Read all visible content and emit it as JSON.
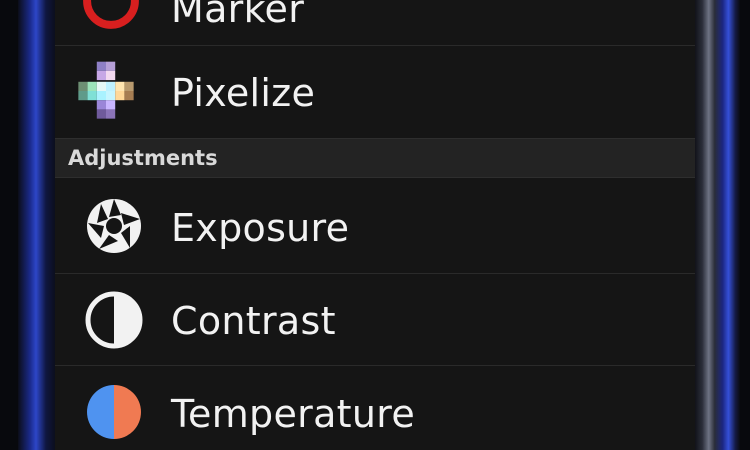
{
  "menu": {
    "items_top": [
      {
        "label": "Marker",
        "icon": "marker-ring-icon"
      },
      {
        "label": "Pixelize",
        "icon": "pixelize-icon"
      }
    ],
    "section": {
      "label": "Adjustments"
    },
    "items_adjust": [
      {
        "label": "Exposure",
        "icon": "aperture-icon"
      },
      {
        "label": "Contrast",
        "icon": "contrast-icon"
      },
      {
        "label": "Temperature",
        "icon": "temperature-icon"
      }
    ]
  },
  "colors": {
    "marker_ring": "#d81f1f",
    "temperature_cool": "#4f93f0",
    "temperature_warm": "#f07a52",
    "text": "#f2f2f2"
  }
}
